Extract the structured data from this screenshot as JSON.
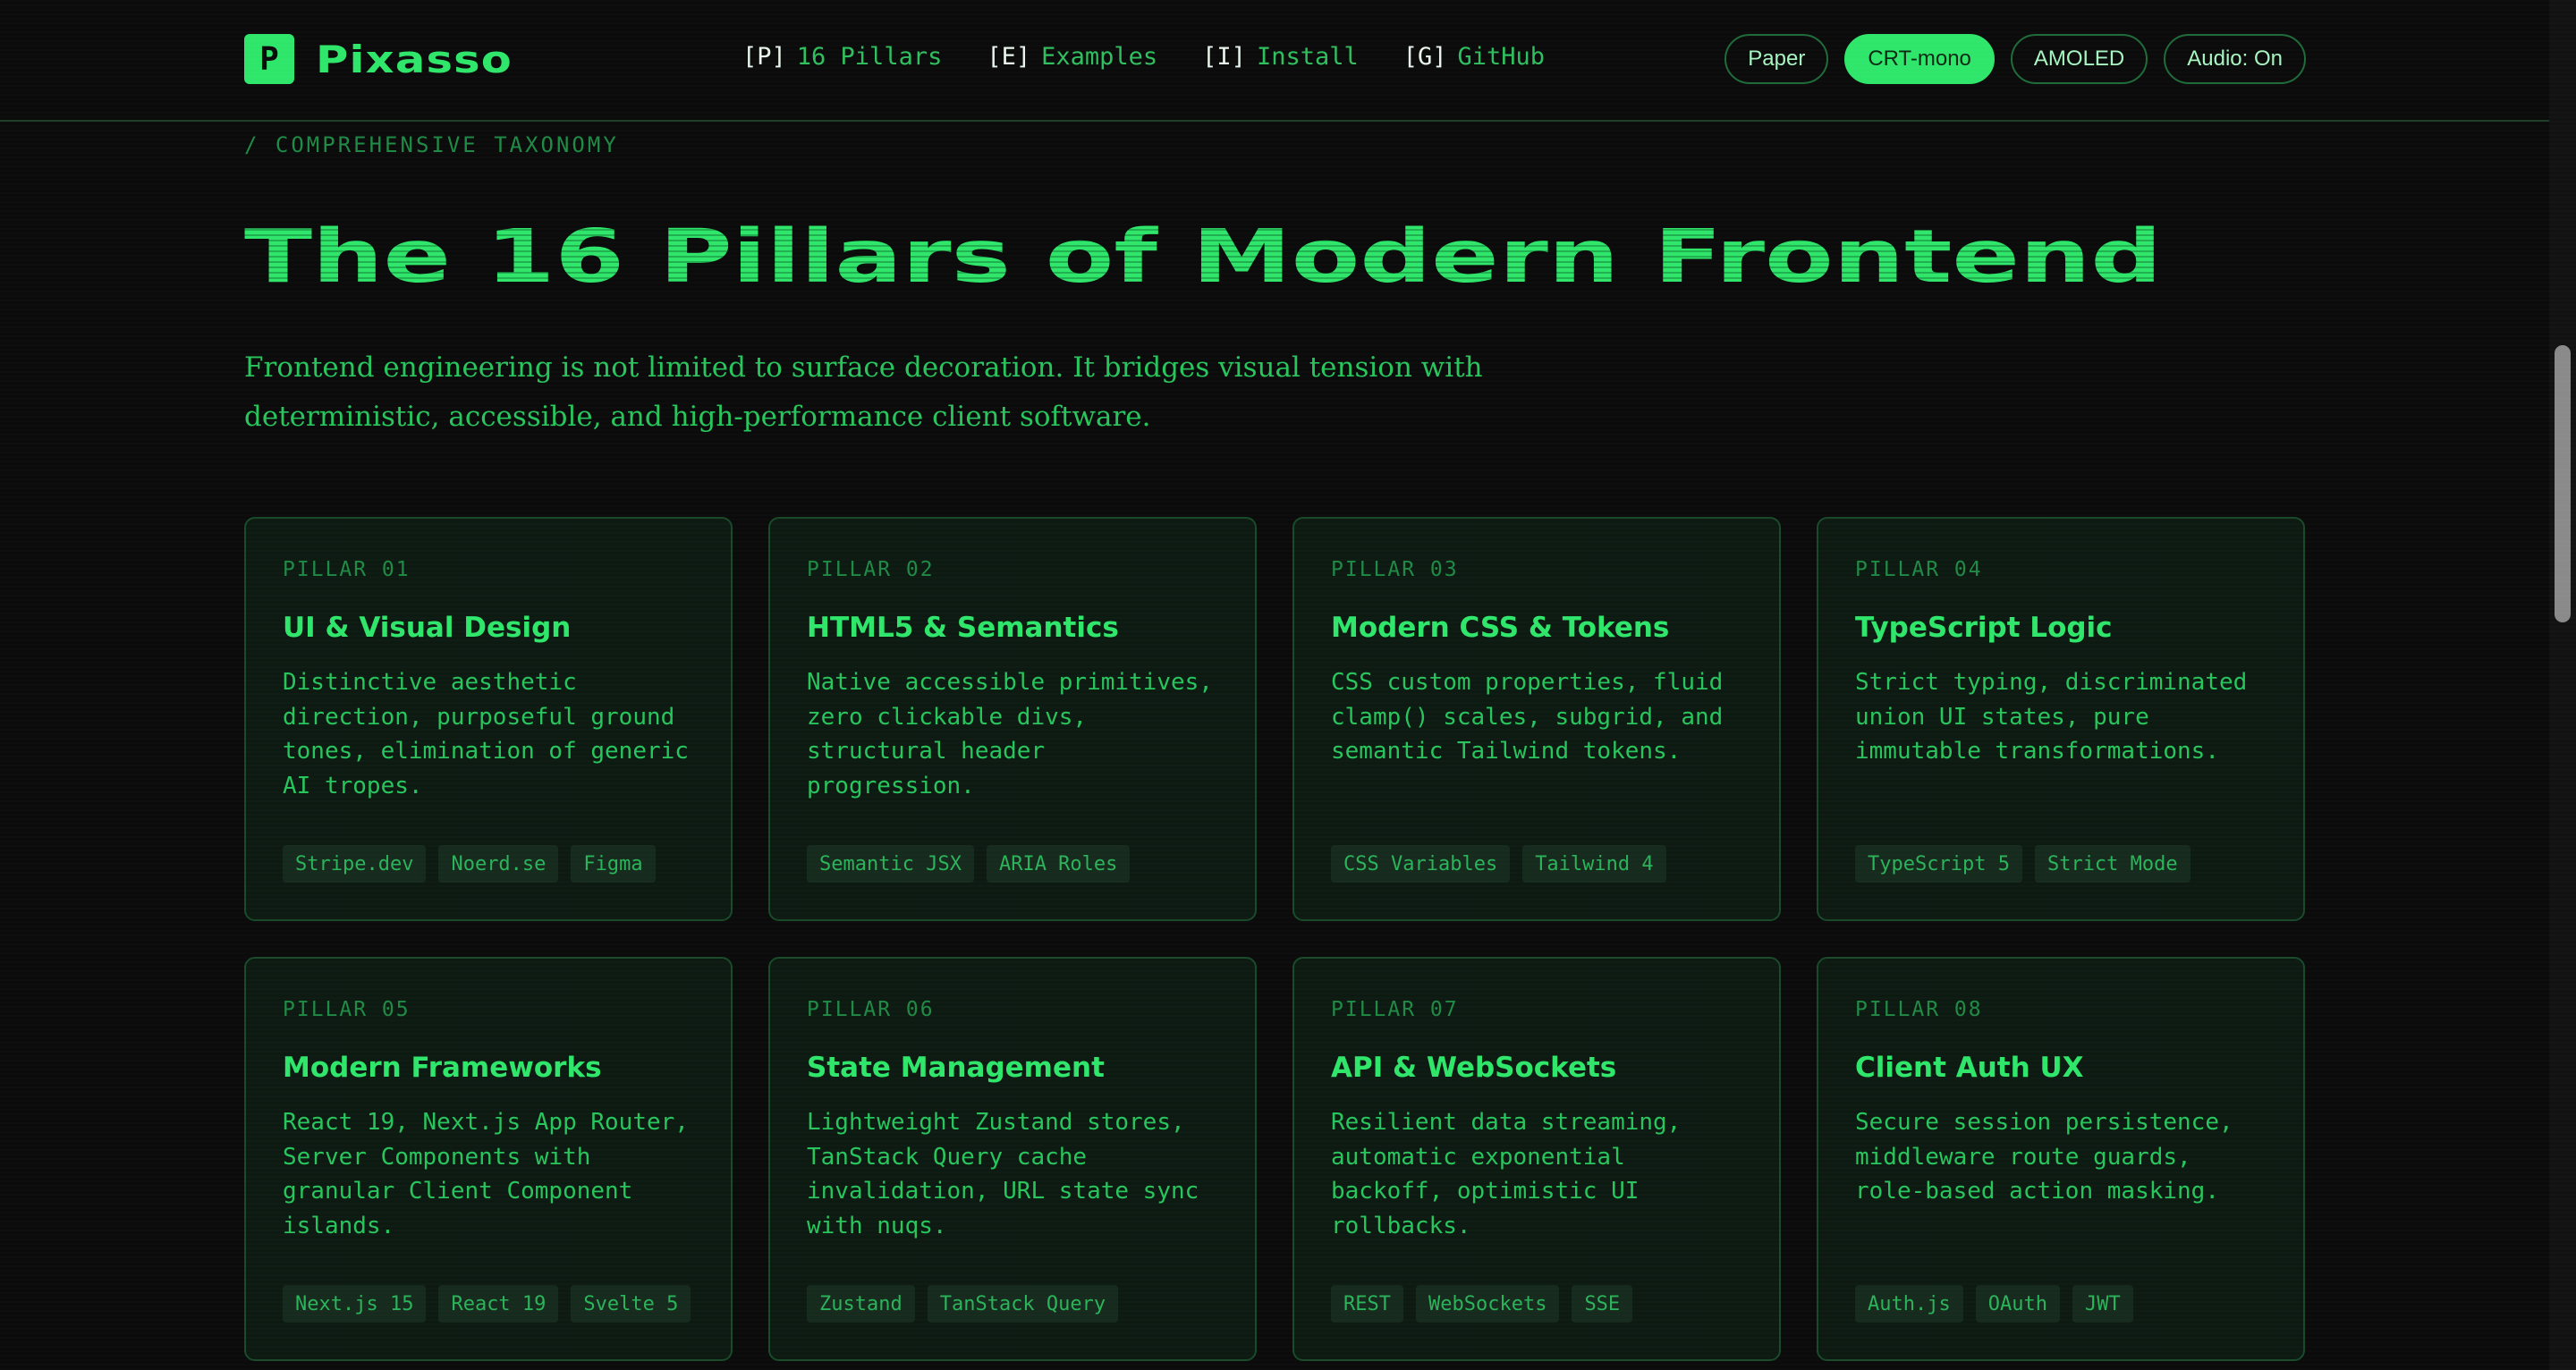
{
  "brand": {
    "logo_letter": "P",
    "name": "Pixasso"
  },
  "nav": [
    {
      "key": "[P]",
      "label": "16 Pillars"
    },
    {
      "key": "[E]",
      "label": "Examples"
    },
    {
      "key": "[I]",
      "label": "Install"
    },
    {
      "key": "[G]",
      "label": "GitHub"
    }
  ],
  "theme_pills": [
    {
      "label": "Paper",
      "active": false
    },
    {
      "label": "CRT-mono",
      "active": true
    },
    {
      "label": "AMOLED",
      "active": false
    },
    {
      "label": "Audio: On",
      "active": false
    }
  ],
  "hero": {
    "eyebrow": "/  COMPREHENSIVE TAXONOMY",
    "title": "The 16 Pillars of Modern Frontend",
    "description": "Frontend engineering is not limited to surface decoration. It bridges visual tension with deterministic, accessible, and high-performance client software."
  },
  "pillars": [
    {
      "kicker": "PILLAR 01",
      "title": "UI & Visual Design",
      "desc": "Distinctive aesthetic direction, purposeful ground tones, elimination of generic AI tropes.",
      "tags": [
        "Stripe.dev",
        "Noerd.se",
        "Figma"
      ]
    },
    {
      "kicker": "PILLAR 02",
      "title": "HTML5 & Semantics",
      "desc": "Native accessible primitives, zero clickable divs, structural header progression.",
      "tags": [
        "Semantic JSX",
        "ARIA Roles"
      ]
    },
    {
      "kicker": "PILLAR 03",
      "title": "Modern CSS & Tokens",
      "desc": "CSS custom properties, fluid clamp() scales, subgrid, and semantic Tailwind tokens.",
      "tags": [
        "CSS Variables",
        "Tailwind 4"
      ]
    },
    {
      "kicker": "PILLAR 04",
      "title": "TypeScript Logic",
      "desc": "Strict typing, discriminated union UI states, pure immutable transformations.",
      "tags": [
        "TypeScript 5",
        "Strict Mode"
      ]
    },
    {
      "kicker": "PILLAR 05",
      "title": "Modern Frameworks",
      "desc": "React 19, Next.js App Router, Server Components with granular Client Component islands.",
      "tags": [
        "Next.js 15",
        "React 19",
        "Svelte 5"
      ]
    },
    {
      "kicker": "PILLAR 06",
      "title": "State Management",
      "desc": "Lightweight Zustand stores, TanStack Query cache invalidation, URL state sync with nuqs.",
      "tags": [
        "Zustand",
        "TanStack Query"
      ]
    },
    {
      "kicker": "PILLAR 07",
      "title": "API & WebSockets",
      "desc": "Resilient data streaming, automatic exponential backoff, optimistic UI rollbacks.",
      "tags": [
        "REST",
        "WebSockets",
        "SSE"
      ]
    },
    {
      "kicker": "PILLAR 08",
      "title": "Client Auth UX",
      "desc": "Secure session persistence, middleware route guards, role-based action masking.",
      "tags": [
        "Auth.js",
        "OAuth",
        "JWT"
      ]
    }
  ]
}
